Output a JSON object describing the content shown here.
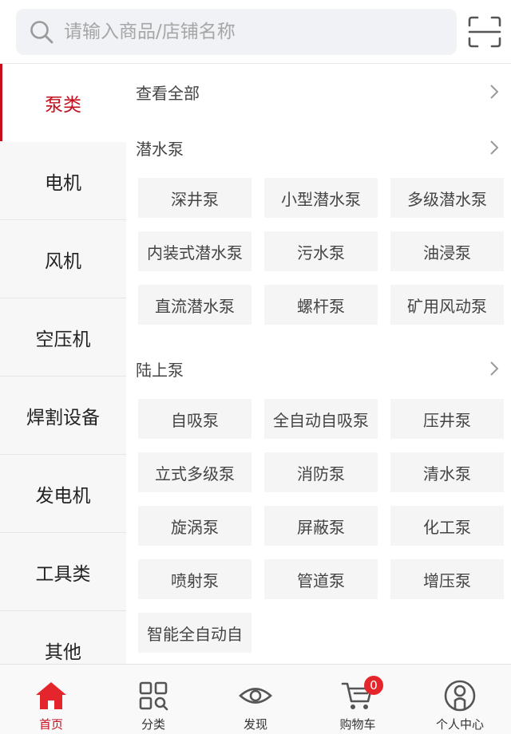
{
  "search": {
    "placeholder": "请输入商品/店铺名称"
  },
  "sidebar": {
    "items": [
      {
        "label": "泵类",
        "active": true
      },
      {
        "label": "电机"
      },
      {
        "label": "风机"
      },
      {
        "label": "空压机"
      },
      {
        "label": "焊割设备"
      },
      {
        "label": "发电机"
      },
      {
        "label": "工具类"
      },
      {
        "label": "其他"
      }
    ]
  },
  "content": {
    "view_all": "查看全部",
    "sections": [
      {
        "title": "潜水泵",
        "items": [
          "深井泵",
          "小型潜水泵",
          "多级潜水泵",
          "内装式潜水泵",
          "污水泵",
          "油浸泵",
          "直流潜水泵",
          "螺杆泵",
          "矿用风动泵"
        ]
      },
      {
        "title": "陆上泵",
        "items": [
          "自吸泵",
          "全自动自吸泵",
          "压井泵",
          "立式多级泵",
          "消防泵",
          "清水泵",
          "旋涡泵",
          "屏蔽泵",
          "化工泵",
          "喷射泵",
          "管道泵",
          "增压泵",
          "智能全自动自"
        ]
      }
    ]
  },
  "tabbar": {
    "items": [
      {
        "label": "首页",
        "icon": "home-icon",
        "active": true
      },
      {
        "label": "分类",
        "icon": "category-icon"
      },
      {
        "label": "发现",
        "icon": "eye-icon"
      },
      {
        "label": "购物车",
        "icon": "cart-icon",
        "badge": "0"
      },
      {
        "label": "个人中心",
        "icon": "user-icon"
      }
    ]
  },
  "colors": {
    "accent": "#c40e1e",
    "badge": "#e4262c",
    "chip_bg": "#f5f5f5",
    "sidebar_bg": "#f7f7f7"
  }
}
